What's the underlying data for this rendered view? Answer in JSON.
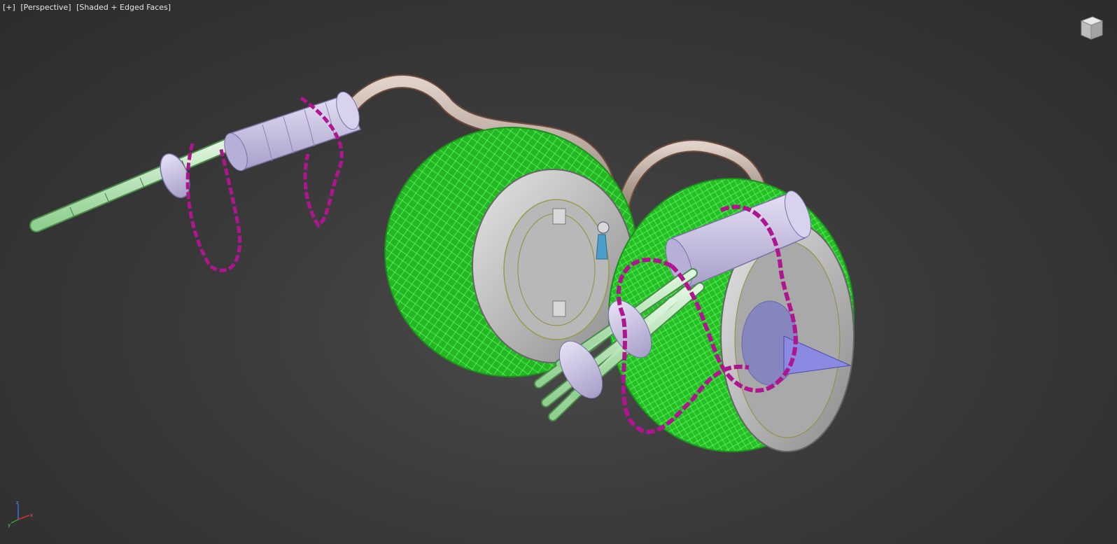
{
  "viewport": {
    "menu_label": "[+]",
    "view_label": "[Perspective]",
    "shading_label": "[Shaded + Edged Faces]"
  },
  "colors": {
    "background": "#3a3a3a",
    "tire_green": "#2ed12e",
    "chain_magenta": "#c0189a",
    "handle_lavender": "#c8bfe3",
    "pipe_tan": "#b39f95",
    "hub_gray": "#c9c9c9",
    "barrel_mint": "#b7e6b7",
    "spike_blue": "#7f7fe0"
  },
  "viewcube": {
    "icon": "viewcube-icon"
  },
  "axis": {
    "x": "x",
    "y": "y",
    "z": "z"
  }
}
